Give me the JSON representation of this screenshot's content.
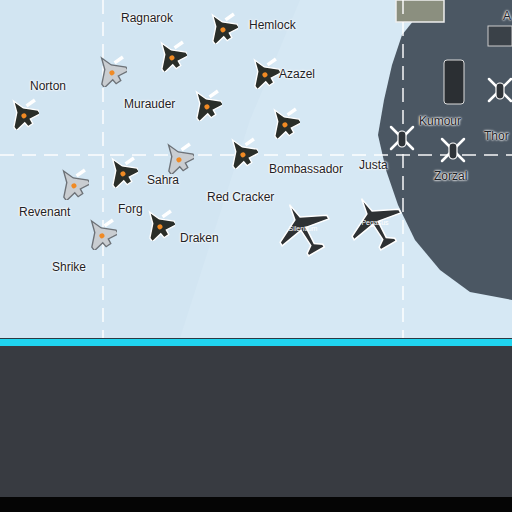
{
  "map": {
    "labels": [
      {
        "text": "Ragnarok"
      },
      {
        "text": "Hemlock"
      },
      {
        "text": "Norton"
      },
      {
        "text": "Azazel"
      },
      {
        "text": "Murauder"
      },
      {
        "text": "Kumour"
      },
      {
        "text": "Thor"
      },
      {
        "text": "A"
      },
      {
        "text": "Sahra"
      },
      {
        "text": "Forg"
      },
      {
        "text": "Revenant"
      },
      {
        "text": "Red Cracker"
      },
      {
        "text": "Bombassador"
      },
      {
        "text": "Justa"
      },
      {
        "text": "Zorzal"
      },
      {
        "text": "Draken"
      },
      {
        "text": "Shrike"
      }
    ],
    "units": [
      {
        "kind": "fighter"
      },
      {
        "kind": "fighter"
      },
      {
        "kind": "fighter"
      },
      {
        "kind": "fighter"
      },
      {
        "kind": "fighter"
      },
      {
        "kind": "fighter"
      },
      {
        "kind": "fighter"
      },
      {
        "kind": "fighter"
      },
      {
        "kind": "fighter"
      },
      {
        "kind": "jet"
      },
      {
        "kind": "jet"
      },
      {
        "kind": "jet"
      },
      {
        "kind": "jet"
      },
      {
        "kind": "transport",
        "text": "Silentium"
      },
      {
        "kind": "transport",
        "text": "Pegasus"
      },
      {
        "kind": "helicopter"
      },
      {
        "kind": "helicopter"
      },
      {
        "kind": "helicopter"
      }
    ]
  }
}
